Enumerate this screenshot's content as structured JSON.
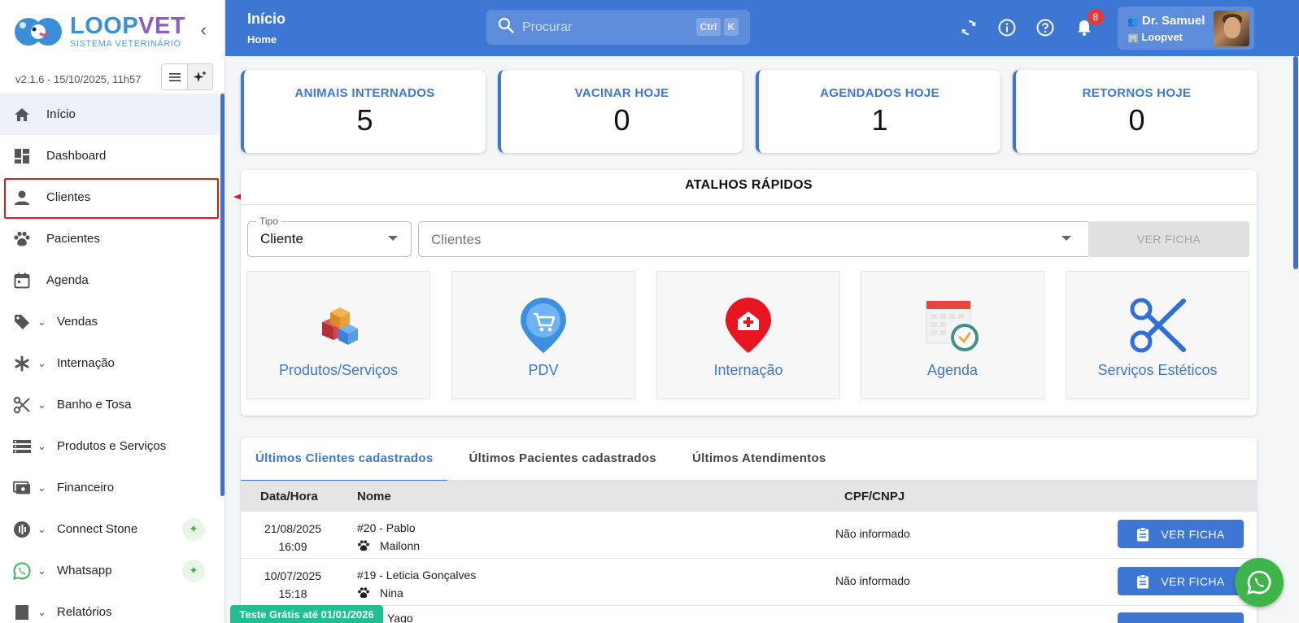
{
  "brand": {
    "name_part1": "LOOP",
    "name_part2": "VET",
    "subtitle": "SISTEMA VETERINÁRIO",
    "version": "v2.1.6 - 15/10/2025, 11h57",
    "accent": "#3d77d3"
  },
  "sidebar": {
    "items": [
      {
        "label": "Início",
        "icon": "home-icon",
        "expandable": false
      },
      {
        "label": "Dashboard",
        "icon": "dashboard-icon",
        "expandable": false
      },
      {
        "label": "Clientes",
        "icon": "person-icon",
        "expandable": false
      },
      {
        "label": "Pacientes",
        "icon": "paw-icon",
        "expandable": false
      },
      {
        "label": "Agenda",
        "icon": "calendar-icon",
        "expandable": false
      },
      {
        "label": "Vendas",
        "icon": "tag-icon",
        "expandable": true
      },
      {
        "label": "Internação",
        "icon": "asterisk-icon",
        "expandable": true
      },
      {
        "label": "Banho e Tosa",
        "icon": "scissors-icon",
        "expandable": true
      },
      {
        "label": "Produtos e Serviços",
        "icon": "list-icon",
        "expandable": true
      },
      {
        "label": "Financeiro",
        "icon": "money-icon",
        "expandable": true
      },
      {
        "label": "Connect Stone",
        "icon": "stone-icon",
        "expandable": true,
        "new": true
      },
      {
        "label": "Whatsapp",
        "icon": "whatsapp-icon",
        "expandable": true,
        "new": true
      },
      {
        "label": "Relatórios",
        "icon": "report-icon",
        "expandable": true
      }
    ]
  },
  "header": {
    "title": "Início",
    "breadcrumb": "Home",
    "search_placeholder": "Procurar",
    "kbd1": "Ctrl",
    "kbd2": "K",
    "notifications": "8",
    "user_name": "Dr. Samuel",
    "user_org": "Loopvet"
  },
  "stats": [
    {
      "label": "ANIMAIS INTERNADOS",
      "value": "5"
    },
    {
      "label": "VACINAR HOJE",
      "value": "0"
    },
    {
      "label": "AGENDADOS HOJE",
      "value": "1"
    },
    {
      "label": "RETORNOS HOJE",
      "value": "0"
    }
  ],
  "shortcuts": {
    "title": "ATALHOS RÁPIDOS",
    "tipo_label": "Tipo",
    "tipo_value": "Cliente",
    "clientes_placeholder": "Clientes",
    "ver_ficha": "VER FICHA",
    "tiles": [
      "Produtos/Serviços",
      "PDV",
      "Internação",
      "Agenda",
      "Serviços Estéticos"
    ]
  },
  "recent": {
    "tabs": [
      "Últimos Clientes cadastrados",
      "Últimos Pacientes cadastrados",
      "Últimos Atendimentos"
    ],
    "columns": [
      "Data/Hora",
      "Nome",
      "CPF/CNPJ"
    ],
    "rows": [
      {
        "date": "21/08/2025",
        "time": "16:09",
        "name": "#20 - Pablo",
        "pet": "Mailonn",
        "doc": "Não informado",
        "action": "VER FICHA"
      },
      {
        "date": "10/07/2025",
        "time": "15:18",
        "name": "#19 - Leticia Gonçalves",
        "pet": "Nina",
        "doc": "Não informado",
        "action": "VER FICHA"
      },
      {
        "date": "",
        "time": "",
        "name": "Yago",
        "pet": "",
        "doc": "",
        "action": ""
      }
    ]
  },
  "trial_badge": "Teste Grátis até 01/01/2026"
}
